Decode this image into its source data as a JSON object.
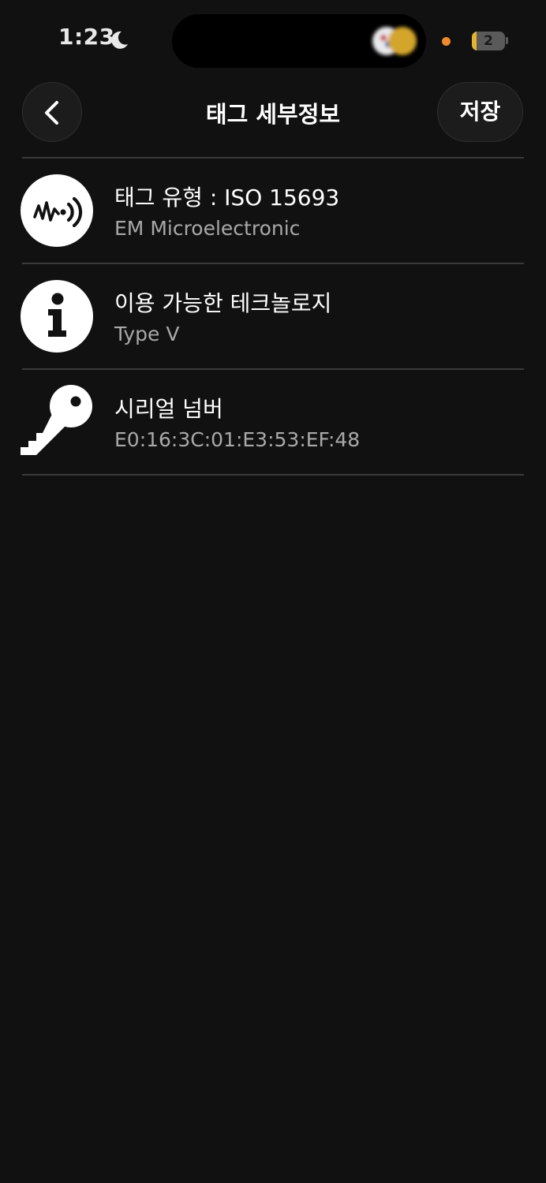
{
  "status_bar": {
    "time": "1:23",
    "battery_level": "2",
    "battery_fraction": 0.15,
    "privacy_dot_color": "#f08a2c"
  },
  "nav": {
    "title": "태그 세부정보",
    "save_label": "저장"
  },
  "details": [
    {
      "icon": "nfc-waveform-icon",
      "title": "태그 유형 : ISO 15693",
      "subtitle": "EM Microelectronic"
    },
    {
      "icon": "info-icon",
      "title": "이용 가능한 테크놀로지",
      "subtitle": "Type V"
    },
    {
      "icon": "key-icon",
      "title": "시리얼 넘버",
      "subtitle": "E0:16:3C:01:E3:53:EF:48"
    }
  ]
}
